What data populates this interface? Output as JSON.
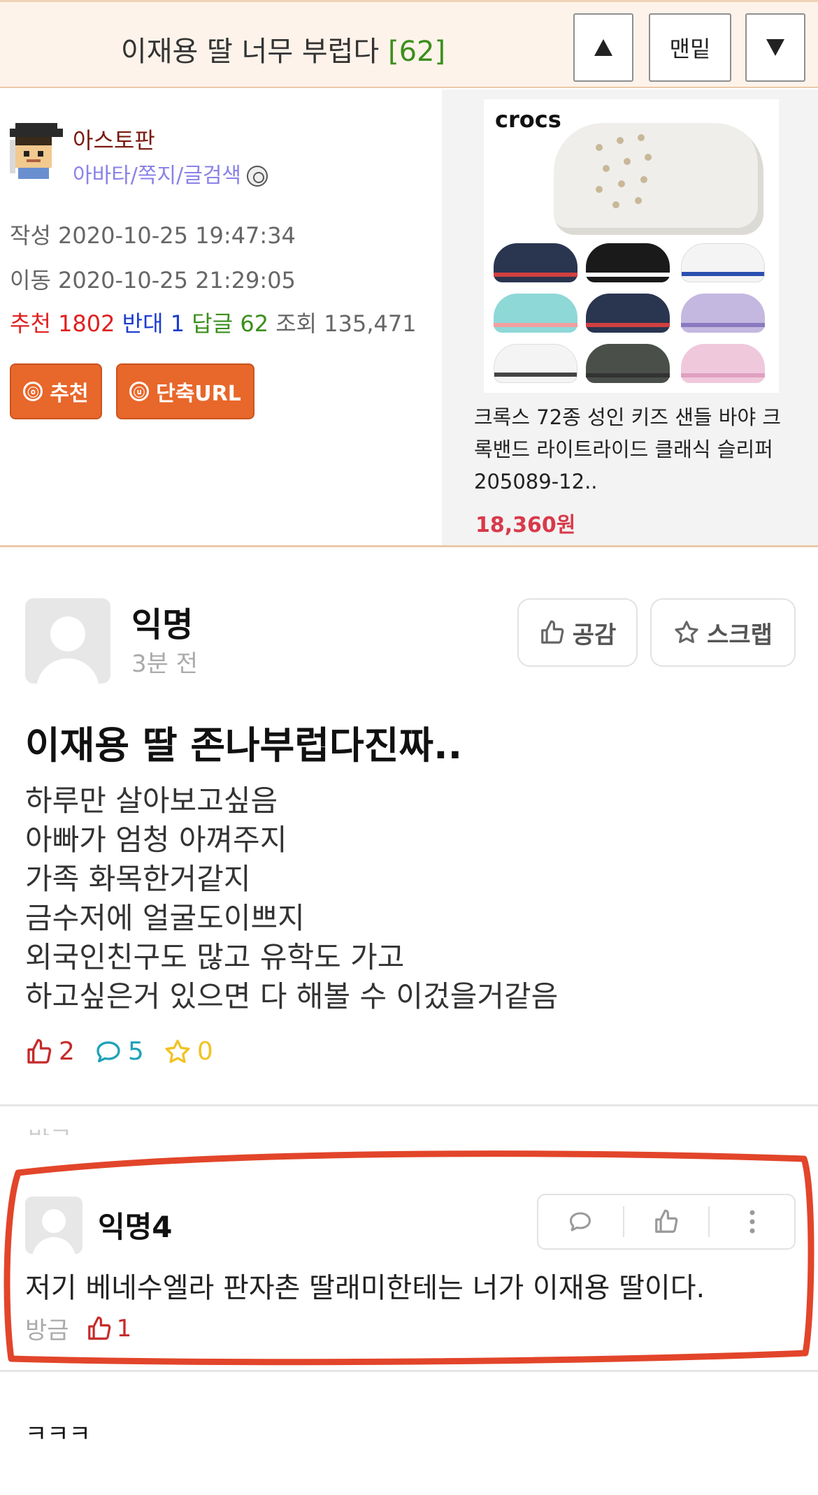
{
  "topbar": {
    "title": "이재용 딸 너무 부럽다",
    "comment_count": "[62]",
    "bottom_label": "맨밑"
  },
  "author": {
    "name": "아스토판",
    "links": "아바타/쪽지/글검색"
  },
  "meta": {
    "created": "작성 2020-10-25 19:47:34",
    "moved": "이동 2020-10-25 21:29:05"
  },
  "stats": {
    "recommend_label": "추천",
    "recommend": "1802",
    "oppose_label": "반대",
    "oppose": "1",
    "replies_label": "답글",
    "replies": "62",
    "views_label": "조회",
    "views": "135,471"
  },
  "buttons": {
    "recommend": "추천",
    "short_url": "단축URL",
    "recommend_icon": "ⓞ",
    "short_url_icon": "ⓤ"
  },
  "ad": {
    "logo": "crocs",
    "title": "크록스 72종 성인 키즈 샌들 바야 크록밴드 라이트라이드 클래식 슬리퍼 205089-12..",
    "price": "18,360원"
  },
  "screenshot": {
    "post": {
      "author": "익명",
      "time": "3분 전",
      "like_label": "공감",
      "scrap_label": "스크랩",
      "title": "이재용 딸 존나부럽다진짜..",
      "body": "하루만 살아보고싶음\n아빠가 엄청 아껴주지\n가족 화목한거같지\n금수저에 얼굴도이쁘지\n외국인친구도 많고 유학도 가고\n하고싶은거 있으면 다 해볼 수 이겄을거같음",
      "likes": "2",
      "comments": "5",
      "scraps": "0"
    },
    "cut_text": "방금",
    "comment": {
      "author": "익명4",
      "text": "저기 베네수엘라 판자촌 딸래미한테는 너가 이재용 딸이다.",
      "time": "방금",
      "likes": "1"
    },
    "reply": "ㅋㅋㅋ"
  },
  "colors": {
    "accent_orange": "#e8672a",
    "highlight_red": "#e2452a",
    "count_green": "#3b8f1c"
  }
}
